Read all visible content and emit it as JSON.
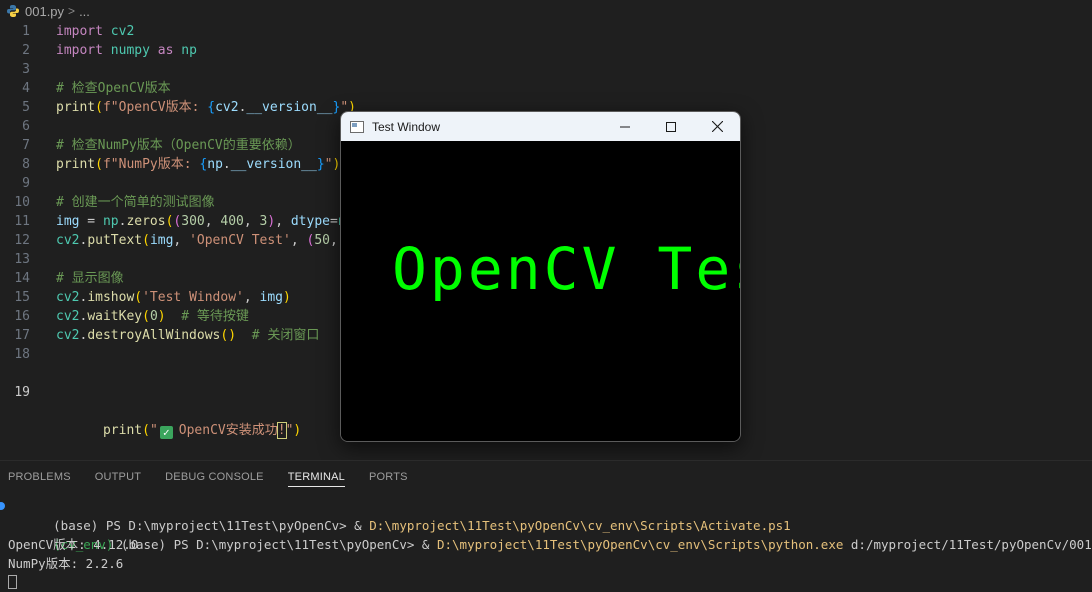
{
  "breadcrumb": {
    "file": "001.py",
    "separator": ">",
    "more": "..."
  },
  "editor": {
    "active_line": "19",
    "lines": [
      {
        "n": "1",
        "tokens": [
          [
            "kw",
            "import"
          ],
          [
            "pun",
            " "
          ],
          [
            "mod",
            "cv2"
          ]
        ]
      },
      {
        "n": "2",
        "tokens": [
          [
            "kw",
            "import"
          ],
          [
            "pun",
            " "
          ],
          [
            "mod",
            "numpy"
          ],
          [
            "pun",
            " "
          ],
          [
            "kw",
            "as"
          ],
          [
            "pun",
            " "
          ],
          [
            "mod",
            "np"
          ]
        ]
      },
      {
        "n": "3",
        "tokens": []
      },
      {
        "n": "4",
        "tokens": [
          [
            "cmt",
            "# 检查OpenCV版本"
          ]
        ]
      },
      {
        "n": "5",
        "tokens": [
          [
            "fn",
            "print"
          ],
          [
            "br1",
            "("
          ],
          [
            "str",
            "f\"OpenCV版本: "
          ],
          [
            "br3",
            "{"
          ],
          [
            "var",
            "cv2"
          ],
          [
            "pun",
            "."
          ],
          [
            "var",
            "__version__"
          ],
          [
            "br3",
            "}"
          ],
          [
            "str",
            "\""
          ],
          [
            "br1",
            ")"
          ]
        ]
      },
      {
        "n": "6",
        "tokens": []
      },
      {
        "n": "7",
        "tokens": [
          [
            "cmt",
            "# 检查NumPy版本（OpenCV的重要依赖）"
          ]
        ]
      },
      {
        "n": "8",
        "tokens": [
          [
            "fn",
            "print"
          ],
          [
            "br1",
            "("
          ],
          [
            "str",
            "f\"NumPy版本: "
          ],
          [
            "br3",
            "{"
          ],
          [
            "var",
            "np"
          ],
          [
            "pun",
            "."
          ],
          [
            "var",
            "__version__"
          ],
          [
            "br3",
            "}"
          ],
          [
            "str",
            "\""
          ],
          [
            "br1",
            ")"
          ]
        ]
      },
      {
        "n": "9",
        "tokens": []
      },
      {
        "n": "10",
        "tokens": [
          [
            "cmt",
            "# 创建一个简单的测试图像"
          ]
        ]
      },
      {
        "n": "11",
        "tokens": [
          [
            "var",
            "img"
          ],
          [
            "pun",
            " = "
          ],
          [
            "mod",
            "np"
          ],
          [
            "pun",
            "."
          ],
          [
            "fn",
            "zeros"
          ],
          [
            "br1",
            "("
          ],
          [
            "br2",
            "("
          ],
          [
            "num",
            "300"
          ],
          [
            "pun",
            ", "
          ],
          [
            "num",
            "400"
          ],
          [
            "pun",
            ", "
          ],
          [
            "num",
            "3"
          ],
          [
            "br2",
            ")"
          ],
          [
            "pun",
            ", "
          ],
          [
            "var",
            "dtype"
          ],
          [
            "pun",
            "="
          ],
          [
            "mod",
            "n"
          ]
        ]
      },
      {
        "n": "12",
        "tokens": [
          [
            "mod",
            "cv2"
          ],
          [
            "pun",
            "."
          ],
          [
            "fn",
            "putText"
          ],
          [
            "br1",
            "("
          ],
          [
            "var",
            "img"
          ],
          [
            "pun",
            ", "
          ],
          [
            "str",
            "'OpenCV Test'"
          ],
          [
            "pun",
            ", "
          ],
          [
            "br2",
            "("
          ],
          [
            "num",
            "50"
          ],
          [
            "pun",
            ", "
          ]
        ]
      },
      {
        "n": "13",
        "tokens": []
      },
      {
        "n": "14",
        "tokens": [
          [
            "cmt",
            "# 显示图像"
          ]
        ]
      },
      {
        "n": "15",
        "tokens": [
          [
            "mod",
            "cv2"
          ],
          [
            "pun",
            "."
          ],
          [
            "fn",
            "imshow"
          ],
          [
            "br1",
            "("
          ],
          [
            "str",
            "'Test Window'"
          ],
          [
            "pun",
            ", "
          ],
          [
            "var",
            "img"
          ],
          [
            "br1",
            ")"
          ]
        ]
      },
      {
        "n": "16",
        "tokens": [
          [
            "mod",
            "cv2"
          ],
          [
            "pun",
            "."
          ],
          [
            "fn",
            "waitKey"
          ],
          [
            "br1",
            "("
          ],
          [
            "num",
            "0"
          ],
          [
            "br1",
            ")"
          ],
          [
            "pun",
            "  "
          ],
          [
            "cmt",
            "# 等待按键"
          ]
        ]
      },
      {
        "n": "17",
        "tokens": [
          [
            "mod",
            "cv2"
          ],
          [
            "pun",
            "."
          ],
          [
            "fn",
            "destroyAllWindows"
          ],
          [
            "br1",
            "()"
          ],
          [
            "pun",
            "  "
          ],
          [
            "cmt",
            "# 关闭窗口"
          ]
        ]
      },
      {
        "n": "18",
        "tokens": []
      }
    ],
    "line19": {
      "n": "19",
      "prefix": "print",
      "open": "(",
      "quote_open": "\"",
      "check_glyph": "✓",
      "text": "OpenCV安装成功",
      "cursor_char": "!",
      "quote_close": "\"",
      "close": ")"
    }
  },
  "window": {
    "title": "Test Window",
    "canvas_text": "OpenCV Test",
    "text_color": "#00ff00"
  },
  "panel": {
    "tabs": [
      "PROBLEMS",
      "OUTPUT",
      "DEBUG CONSOLE",
      "TERMINAL",
      "PORTS"
    ],
    "active_tab": "TERMINAL",
    "terminal": {
      "line1_prompt": "(base) PS D:\\myproject\\11Test\\pyOpenCv> & ",
      "line1_path": "D:\\myproject\\11Test\\pyOpenCv\\cv_env\\Scripts\\Activate.ps1",
      "line2_env": "(cv_env)",
      "line2_prompt": " (base) PS D:\\myproject\\11Test\\pyOpenCv> & ",
      "line2_path": "D:\\myproject\\11Test\\pyOpenCv\\cv_env\\Scripts\\python.exe",
      "line2_arg": " d:/myproject/11Test/pyOpenCv/001.py",
      "line3": "OpenCV版本: 4.12.0",
      "line4": "NumPy版本: 2.2.6"
    }
  },
  "colors": {
    "background": "#1f1f1f",
    "accent": "#3794ff"
  }
}
